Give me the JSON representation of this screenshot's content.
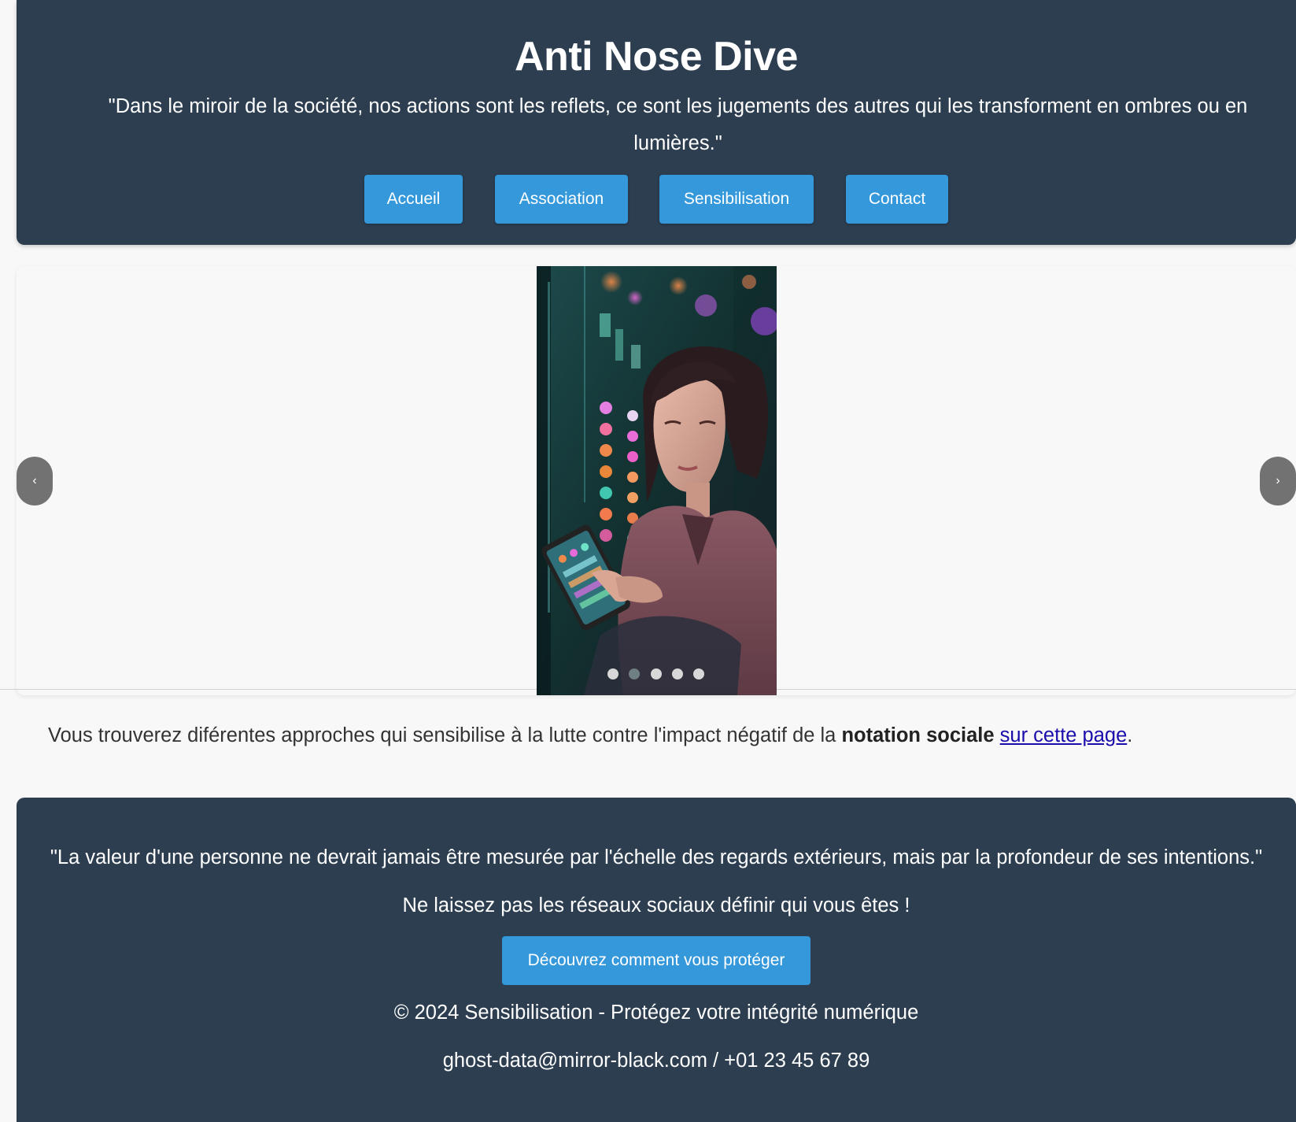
{
  "header": {
    "title": "Anti Nose Dive",
    "tagline": "\"Dans le miroir de la société, nos actions sont les reflets, ce sont les jugements des autres qui les transforment en ombres ou en lumières.\"",
    "nav": [
      {
        "label": "Accueil"
      },
      {
        "label": "Association"
      },
      {
        "label": "Sensibilisation"
      },
      {
        "label": "Contact"
      }
    ]
  },
  "carousel": {
    "prev_label": "‹",
    "next_label": "›",
    "slide_count": 5,
    "active_slide": 2
  },
  "intro": {
    "text_before": "Vous trouverez diférentes approches qui sensibilise à la lutte contre l'impact négatif de la ",
    "bold": "notation sociale",
    "space": " ",
    "link_text": "sur cette page",
    "text_after": "."
  },
  "footer": {
    "quote": "\"La valeur d'une personne ne devrait jamais être mesurée par l'échelle des regards extérieurs, mais par la profondeur de ses intentions.\"",
    "message": "Ne laissez pas les réseaux sociaux définir qui vous êtes !",
    "cta_label": "Découvrez comment vous protéger",
    "copyright": "© 2024 Sensibilisation - Protégez votre intégrité numérique",
    "contact": "ghost-data@mirror-black.com / +01 23 45 67 89"
  },
  "colors": {
    "header_bg": "#2c3e50",
    "button_bg": "#3498db",
    "page_bg": "#f8f8f8",
    "link": "#1a0dab"
  }
}
